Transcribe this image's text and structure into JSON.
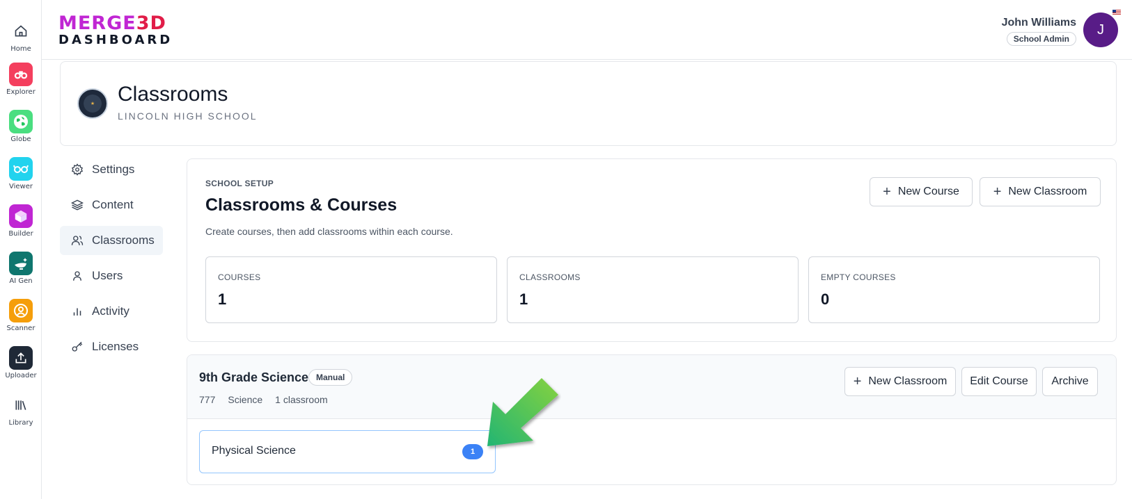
{
  "rail": {
    "items": [
      {
        "label": "Home",
        "icon": "home-icon"
      },
      {
        "label": "Explorer",
        "icon": "binoculars-icon",
        "color": "#f43f5e"
      },
      {
        "label": "Globe",
        "icon": "globe-icon",
        "color": "#4ade80"
      },
      {
        "label": "Viewer",
        "icon": "glasses-icon",
        "color": "#22d3ee"
      },
      {
        "label": "Builder",
        "icon": "cube-icon",
        "color": "#c026d3"
      },
      {
        "label": "AI Gen",
        "icon": "magic-lamp-icon",
        "color": "#0f766e"
      },
      {
        "label": "Scanner",
        "icon": "scanner-icon",
        "color": "#f59e0b"
      },
      {
        "label": "Uploader",
        "icon": "upload-icon",
        "color": "#1f2937"
      },
      {
        "label": "Library",
        "icon": "library-icon"
      }
    ]
  },
  "header": {
    "logo_top_left": "MERGE",
    "logo_top_right": "3D",
    "logo_bottom": "DASHBOARD",
    "user_name": "John Williams",
    "user_role": "School Admin",
    "avatar_initial": "J"
  },
  "page": {
    "title": "Classrooms",
    "subtitle": "LINCOLN HIGH SCHOOL"
  },
  "sidenav": {
    "items": [
      {
        "label": "Settings",
        "icon": "gear-icon"
      },
      {
        "label": "Content",
        "icon": "layers-icon"
      },
      {
        "label": "Classrooms",
        "icon": "users-icon",
        "active": true
      },
      {
        "label": "Users",
        "icon": "user-icon"
      },
      {
        "label": "Activity",
        "icon": "bar-chart-icon"
      },
      {
        "label": "Licenses",
        "icon": "key-icon"
      }
    ]
  },
  "setup": {
    "eyebrow": "SCHOOL SETUP",
    "title": "Classrooms & Courses",
    "description": "Create courses, then add classrooms within each course.",
    "new_course_label": "New Course",
    "new_classroom_label": "New Classroom",
    "stats": [
      {
        "label": "COURSES",
        "value": "1"
      },
      {
        "label": "CLASSROOMS",
        "value": "1"
      },
      {
        "label": "EMPTY COURSES",
        "value": "0"
      }
    ]
  },
  "course": {
    "title": "9th Grade Science",
    "badge": "Manual",
    "meta": [
      "777",
      "Science",
      "1 classroom"
    ],
    "new_classroom_label": "New Classroom",
    "edit_label": "Edit Course",
    "archive_label": "Archive",
    "classrooms": [
      {
        "name": "Physical Science",
        "count": "1"
      }
    ]
  },
  "colors": {
    "accent": "#3b82f6",
    "avatar": "#581c87",
    "arrow": "#4ade80"
  }
}
